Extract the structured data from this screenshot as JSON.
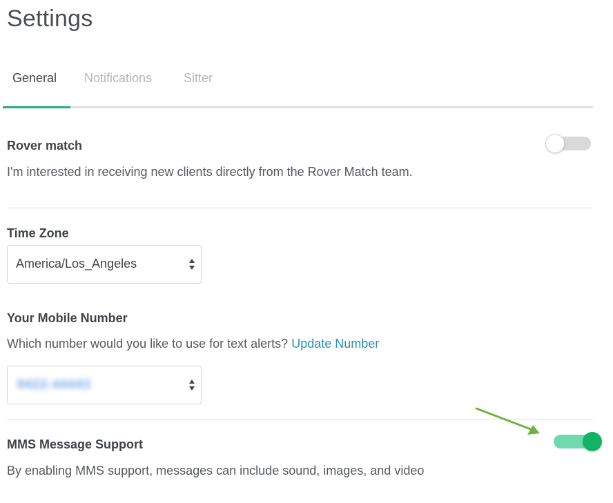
{
  "header": {
    "title": "Settings"
  },
  "tabs": [
    {
      "label": "General",
      "active": true
    },
    {
      "label": "Notifications",
      "active": false
    },
    {
      "label": "Sitter",
      "active": false
    }
  ],
  "rover_match": {
    "title": "Rover match",
    "description": "I'm interested in receiving new clients directly from the Rover Match team.",
    "enabled": false
  },
  "time_zone": {
    "label": "Time Zone",
    "selected": "America/Los_Angeles"
  },
  "mobile": {
    "label": "Your Mobile Number",
    "question": "Which number would you like to use for text alerts?",
    "update_link": "Update Number",
    "selected": "9422-44443"
  },
  "mms": {
    "title": "MMS Message Support",
    "description": "By enabling MMS support, messages can include sound, images, and video",
    "enabled": true
  },
  "colors": {
    "accent": "#1eaf74",
    "toggle_on_knob": "#12b463",
    "toggle_on_track": "#72d8ad",
    "link": "#2a8fb6",
    "annotation_arrow": "#6db33f"
  }
}
